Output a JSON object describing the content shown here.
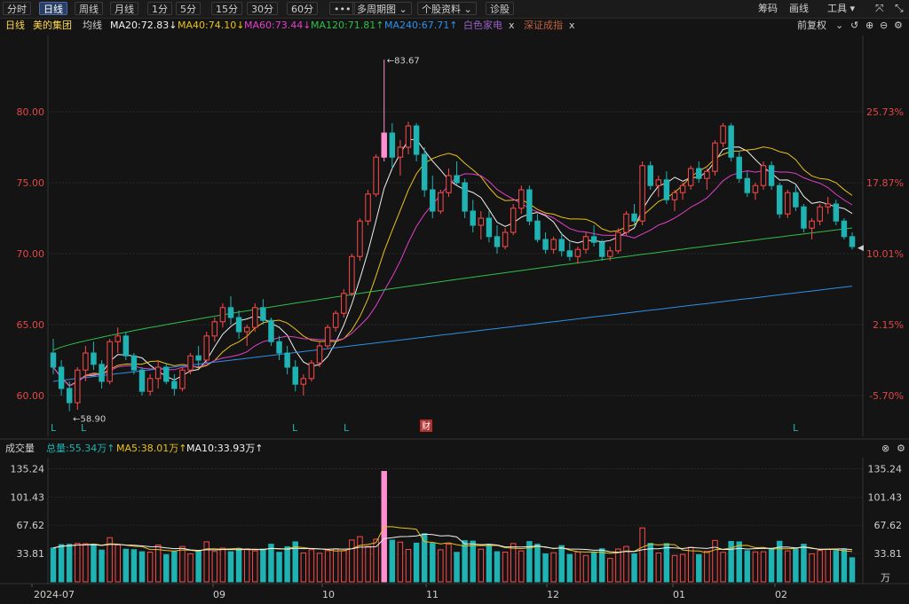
{
  "toolbar": {
    "periods": [
      "分时",
      "日线",
      "周线",
      "月线",
      "1分",
      "5分",
      "15分",
      "30分",
      "60分"
    ],
    "active_period": "日线",
    "more_label": "•••",
    "multi_period": "多周期图 ⌄",
    "stock_info": "个股资料 ⌄",
    "diagnose": "诊股",
    "chips": "筹码",
    "draw": "画线",
    "tools": "工具 ▾"
  },
  "ma_bar": {
    "period": "日线",
    "stock_name": "美的集团",
    "ma_label": "均线",
    "ma20": "MA20:72.83↓",
    "ma40": "MA40:74.10↓",
    "ma60": "MA60:73.44↓",
    "ma120": "MA120:71.81↑",
    "ma240": "MA240:67.71↑",
    "compare1": "白色家电",
    "compare2": "深证成指",
    "close_x": "x",
    "adjust": "前复权"
  },
  "colors": {
    "up": "#ff4a4a",
    "down": "#1fb3b3",
    "ma20": "#f0f0f0",
    "ma40": "#e8c21a",
    "ma60": "#e040c8",
    "ma120": "#2fbf4a",
    "ma240": "#2f8fe8",
    "highlight": "#ff8fd0"
  },
  "price_axis": {
    "left_ticks": [
      "80.00",
      "75.00",
      "70.00",
      "65.00",
      "60.00"
    ],
    "right_ticks": [
      "25.73%",
      "17.87%",
      "10.01%",
      "2.15%",
      "-5.70%"
    ],
    "high_label": "←83.67",
    "low_label": "←58.90",
    "markers": [
      "L",
      "L",
      "L",
      "L",
      "L"
    ],
    "event_marker": "财"
  },
  "volume": {
    "title": "成交量",
    "total": "总量:55.34万↑",
    "ma5": "MA5:38.01万↑",
    "ma10": "MA10:33.93万↑",
    "ticks": [
      "135.24",
      "101.43",
      "67.62",
      "33.81"
    ],
    "unit": "万",
    "dates": [
      "2024-07",
      "09",
      "10",
      "11",
      "12",
      "01",
      "02"
    ]
  },
  "chart_data": {
    "type": "candlestick",
    "series": [
      {
        "name": "MA20",
        "value": 72.83
      },
      {
        "name": "MA40",
        "value": 74.1
      },
      {
        "name": "MA60",
        "value": 73.44
      },
      {
        "name": "MA120",
        "value": 71.81
      },
      {
        "name": "MA240",
        "value": 67.71
      }
    ],
    "ylim": [
      58,
      85
    ],
    "high": 83.67,
    "low": 58.9,
    "candles": [
      [
        63.0,
        64.0,
        61.5,
        62.0
      ],
      [
        62.0,
        62.5,
        60.0,
        60.5
      ],
      [
        60.5,
        61.0,
        58.9,
        59.5
      ],
      [
        59.5,
        62.0,
        59.0,
        61.8
      ],
      [
        61.8,
        63.5,
        61.0,
        63.0
      ],
      [
        63.0,
        63.8,
        61.8,
        62.2
      ],
      [
        62.2,
        62.5,
        60.5,
        61.0
      ],
      [
        61.0,
        64.0,
        60.8,
        63.8
      ],
      [
        63.8,
        64.8,
        63.0,
        64.2
      ],
      [
        64.2,
        64.5,
        62.5,
        62.8
      ],
      [
        62.8,
        63.0,
        61.5,
        61.8
      ],
      [
        61.8,
        62.0,
        60.0,
        60.3
      ],
      [
        60.3,
        61.5,
        60.0,
        61.2
      ],
      [
        61.2,
        62.5,
        60.5,
        62.0
      ],
      [
        62.0,
        62.3,
        60.8,
        61.0
      ],
      [
        61.0,
        61.5,
        60.0,
        60.5
      ],
      [
        60.5,
        62.0,
        60.3,
        61.8
      ],
      [
        61.8,
        63.0,
        61.5,
        62.8
      ],
      [
        62.8,
        63.5,
        62.0,
        62.5
      ],
      [
        62.5,
        64.5,
        62.3,
        64.2
      ],
      [
        64.2,
        65.5,
        63.8,
        65.2
      ],
      [
        65.2,
        66.5,
        64.8,
        66.2
      ],
      [
        66.2,
        67.0,
        65.0,
        65.5
      ],
      [
        65.5,
        66.0,
        64.0,
        64.5
      ],
      [
        64.5,
        65.0,
        63.5,
        64.8
      ],
      [
        64.8,
        66.5,
        64.5,
        66.2
      ],
      [
        66.2,
        66.8,
        65.0,
        65.3
      ],
      [
        65.3,
        65.5,
        63.5,
        63.8
      ],
      [
        63.8,
        64.2,
        62.5,
        63.0
      ],
      [
        63.0,
        63.5,
        61.5,
        62.0
      ],
      [
        62.0,
        62.5,
        60.3,
        60.8
      ],
      [
        60.8,
        61.5,
        60.0,
        61.2
      ],
      [
        61.2,
        62.5,
        61.0,
        62.3
      ],
      [
        62.3,
        63.8,
        62.0,
        63.5
      ],
      [
        63.5,
        65.0,
        63.3,
        64.8
      ],
      [
        64.8,
        66.0,
        64.5,
        65.8
      ],
      [
        65.8,
        67.5,
        65.5,
        67.2
      ],
      [
        67.2,
        70.0,
        67.0,
        69.8
      ],
      [
        69.8,
        72.5,
        69.5,
        72.3
      ],
      [
        72.3,
        74.5,
        72.0,
        74.2
      ],
      [
        74.2,
        77.0,
        74.0,
        76.8
      ],
      [
        76.8,
        83.67,
        76.5,
        78.5
      ],
      [
        78.5,
        79.2,
        76.0,
        76.8
      ],
      [
        76.8,
        78.0,
        75.5,
        77.5
      ],
      [
        77.5,
        79.3,
        77.0,
        79.0
      ],
      [
        79.0,
        79.2,
        76.5,
        77.0
      ],
      [
        77.0,
        77.5,
        74.0,
        74.5
      ],
      [
        74.5,
        75.5,
        72.5,
        73.0
      ],
      [
        73.0,
        74.5,
        72.8,
        74.3
      ],
      [
        74.3,
        76.0,
        74.0,
        75.5
      ],
      [
        75.5,
        76.5,
        74.8,
        75.0
      ],
      [
        75.0,
        75.3,
        72.5,
        73.0
      ],
      [
        73.0,
        73.8,
        71.5,
        72.0
      ],
      [
        72.0,
        73.0,
        71.0,
        72.5
      ],
      [
        72.5,
        73.0,
        70.8,
        71.2
      ],
      [
        71.2,
        72.0,
        70.0,
        70.5
      ],
      [
        70.5,
        71.8,
        70.3,
        71.5
      ],
      [
        71.5,
        73.5,
        71.3,
        73.2
      ],
      [
        73.2,
        74.8,
        72.8,
        74.5
      ],
      [
        74.5,
        74.8,
        72.0,
        72.3
      ],
      [
        72.3,
        72.8,
        70.8,
        71.0
      ],
      [
        71.0,
        71.5,
        70.0,
        70.3
      ],
      [
        70.3,
        71.2,
        70.0,
        71.0
      ],
      [
        71.0,
        71.5,
        69.8,
        70.2
      ],
      [
        70.2,
        70.8,
        69.5,
        69.8
      ],
      [
        69.8,
        70.5,
        69.3,
        70.3
      ],
      [
        70.3,
        71.5,
        70.0,
        71.2
      ],
      [
        71.2,
        72.0,
        70.5,
        70.8
      ],
      [
        70.8,
        71.0,
        69.5,
        69.8
      ],
      [
        69.8,
        70.5,
        69.5,
        70.2
      ],
      [
        70.2,
        71.8,
        70.0,
        71.5
      ],
      [
        71.5,
        73.0,
        71.3,
        72.8
      ],
      [
        72.8,
        73.5,
        72.0,
        72.3
      ],
      [
        72.3,
        76.5,
        72.0,
        76.2
      ],
      [
        76.2,
        76.5,
        74.5,
        74.8
      ],
      [
        74.8,
        75.5,
        74.0,
        75.2
      ],
      [
        75.2,
        75.8,
        73.5,
        73.8
      ],
      [
        73.8,
        74.5,
        73.0,
        74.3
      ],
      [
        74.3,
        75.0,
        73.8,
        74.8
      ],
      [
        74.8,
        76.2,
        74.5,
        76.0
      ],
      [
        76.0,
        76.5,
        75.0,
        75.3
      ],
      [
        75.3,
        76.0,
        74.5,
        75.8
      ],
      [
        75.8,
        78.0,
        75.5,
        77.8
      ],
      [
        77.8,
        79.2,
        77.5,
        79.0
      ],
      [
        79.0,
        79.2,
        76.5,
        76.8
      ],
      [
        76.8,
        77.2,
        75.0,
        75.3
      ],
      [
        75.3,
        75.8,
        74.0,
        74.3
      ],
      [
        74.3,
        75.0,
        73.8,
        74.8
      ],
      [
        74.8,
        76.5,
        74.5,
        76.2
      ],
      [
        76.2,
        76.5,
        74.5,
        74.8
      ],
      [
        74.8,
        75.0,
        72.5,
        72.8
      ],
      [
        72.8,
        74.5,
        72.5,
        74.3
      ],
      [
        74.3,
        74.8,
        73.0,
        73.3
      ],
      [
        73.3,
        73.5,
        71.5,
        71.8
      ],
      [
        71.8,
        72.5,
        71.0,
        72.3
      ],
      [
        72.3,
        73.5,
        72.0,
        73.3
      ],
      [
        73.3,
        74.0,
        72.8,
        73.5
      ],
      [
        73.5,
        73.8,
        72.0,
        72.3
      ],
      [
        72.3,
        72.5,
        71.0,
        71.2
      ],
      [
        71.2,
        71.5,
        70.3,
        70.5
      ]
    ]
  }
}
